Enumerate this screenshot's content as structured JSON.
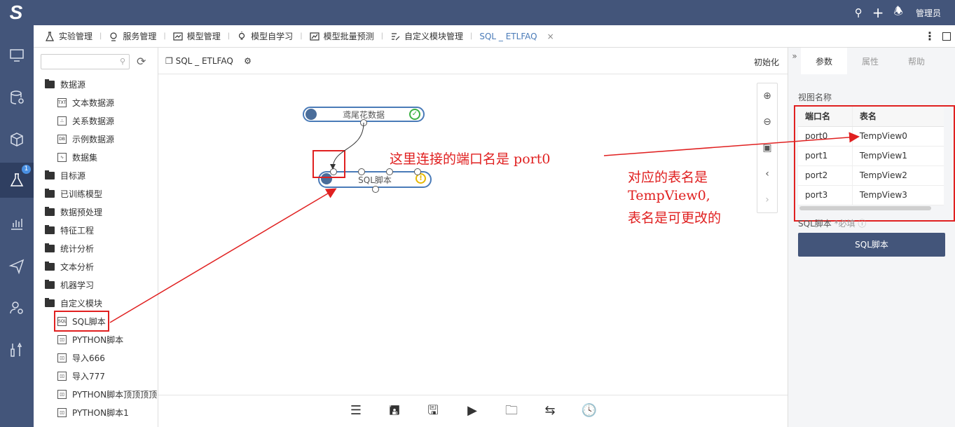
{
  "topbar": {
    "logo": "S",
    "user_label": "管理员"
  },
  "nav": {
    "badge": "1"
  },
  "tabs": [
    {
      "label": "实验管理"
    },
    {
      "label": "服务管理"
    },
    {
      "label": "模型管理"
    },
    {
      "label": "模型自学习"
    },
    {
      "label": "模型批量预测"
    },
    {
      "label": "自定义模块管理"
    },
    {
      "label": "SQL _ ETLFAQ"
    }
  ],
  "tab_close": "×",
  "tree": {
    "items": [
      {
        "label": "数据源",
        "kind": "folder"
      },
      {
        "label": "文本数据源",
        "kind": "leaf"
      },
      {
        "label": "关系数据源",
        "kind": "leaf"
      },
      {
        "label": "示例数据源",
        "kind": "leaf"
      },
      {
        "label": "数据集",
        "kind": "leaf"
      },
      {
        "label": "目标源",
        "kind": "folder"
      },
      {
        "label": "已训练模型",
        "kind": "folder"
      },
      {
        "label": "数据预处理",
        "kind": "folder"
      },
      {
        "label": "特征工程",
        "kind": "folder"
      },
      {
        "label": "统计分析",
        "kind": "folder"
      },
      {
        "label": "文本分析",
        "kind": "folder"
      },
      {
        "label": "机器学习",
        "kind": "folder"
      },
      {
        "label": "自定义模块",
        "kind": "folder"
      },
      {
        "label": "SQL脚本",
        "kind": "leaf"
      },
      {
        "label": "PYTHON脚本",
        "kind": "leaf"
      },
      {
        "label": "导入666",
        "kind": "leaf"
      },
      {
        "label": "导入777",
        "kind": "leaf"
      },
      {
        "label": "PYTHON脚本顶顶顶顶",
        "kind": "leaf"
      },
      {
        "label": "PYTHON脚本1",
        "kind": "leaf"
      }
    ]
  },
  "canvas": {
    "title": "SQL _ ETLFAQ",
    "init_label": "初始化",
    "node_iris": "鸢尾花数据",
    "node_sql": "SQL脚本"
  },
  "annotations": {
    "a1": "这里连接的端口名是 port0",
    "a2_line1": "对应的表名是",
    "a2_line2": "TempView0,",
    "a2_line3": "表名是可更改的"
  },
  "right_panel": {
    "tabs": [
      "参数",
      "属性",
      "帮助"
    ],
    "view_name_label": "视图名称",
    "table_headers": [
      "端口名",
      "表名"
    ],
    "rows": [
      [
        "port0",
        "TempView0"
      ],
      [
        "port1",
        "TempView1"
      ],
      [
        "port2",
        "TempView2"
      ],
      [
        "port3",
        "TempView3"
      ]
    ],
    "sql_label": "SQL脚本",
    "required": "*必填",
    "sql_button": "SQL脚本"
  },
  "colors": {
    "header": "#43557a",
    "accent": "#4a7bb8",
    "annotation": "#e02020"
  }
}
